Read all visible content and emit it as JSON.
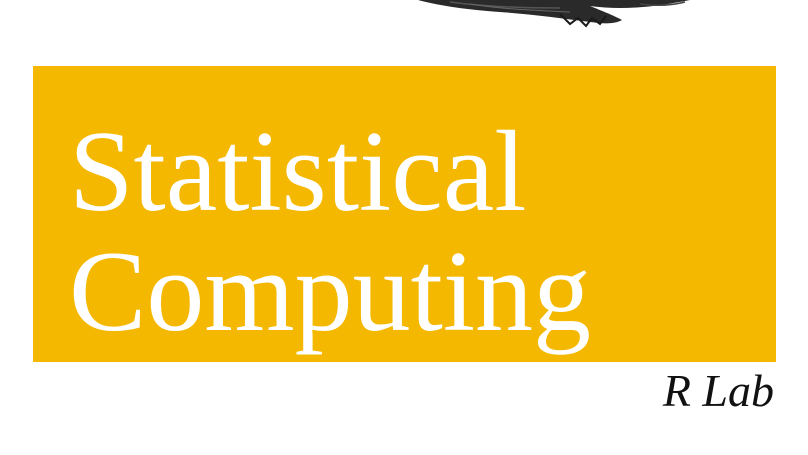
{
  "cover": {
    "title_line_1": "Statistical",
    "title_line_2": "Computing",
    "subtitle": "R Lab",
    "band_color": "#f5b800",
    "illustration": "bird-engraving-icon"
  }
}
